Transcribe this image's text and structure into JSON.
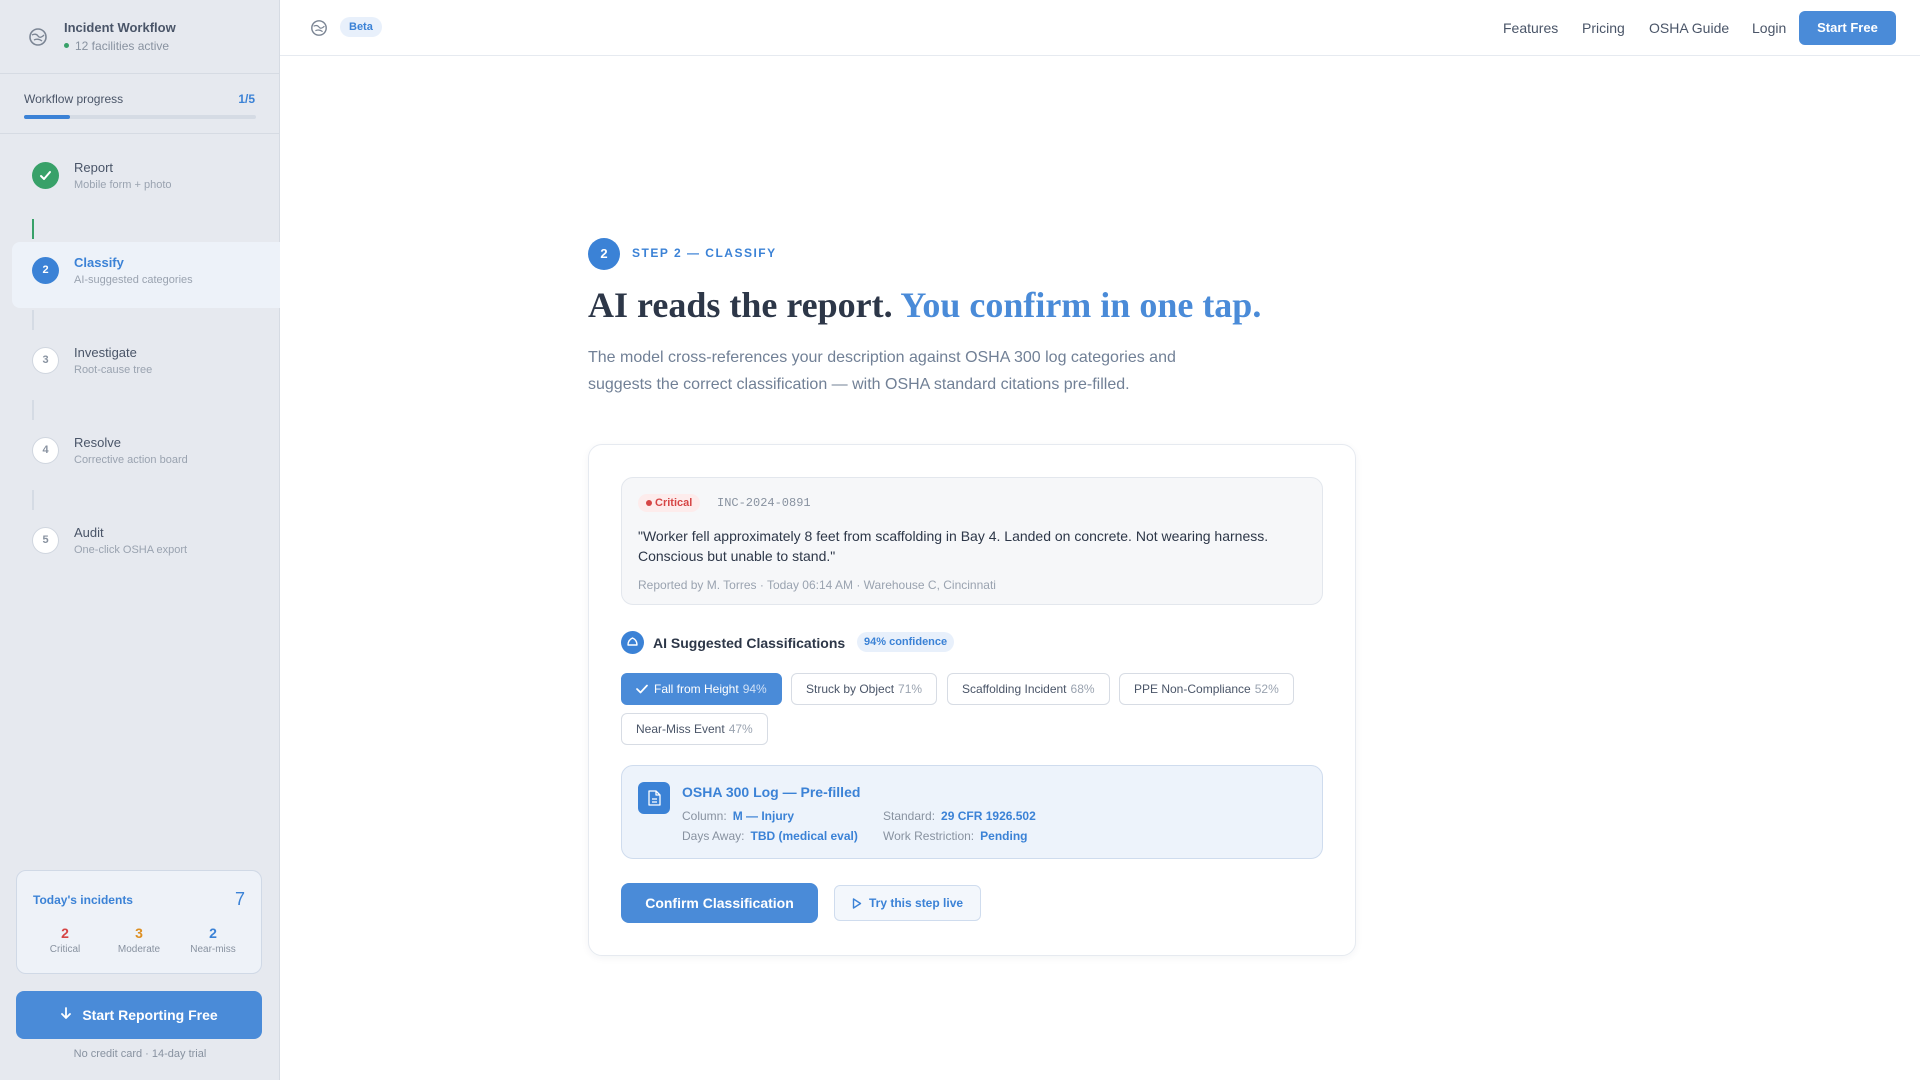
{
  "sidebar": {
    "title": "Incident Workflow",
    "subtitle": "12 facilities active",
    "progress": {
      "label": "Workflow progress",
      "count": "1/5",
      "fraction": 0.2
    },
    "steps": [
      {
        "num": "",
        "title": "Report",
        "desc": "Mobile form + photo",
        "state": "done"
      },
      {
        "num": "2",
        "title": "Classify",
        "desc": "AI-suggested categories",
        "state": "current"
      },
      {
        "num": "3",
        "title": "Investigate",
        "desc": "Root-cause tree",
        "state": "todo"
      },
      {
        "num": "4",
        "title": "Resolve",
        "desc": "Corrective action board",
        "state": "todo"
      },
      {
        "num": "5",
        "title": "Audit",
        "desc": "One-click OSHA export",
        "state": "todo"
      }
    ],
    "incidents": {
      "title": "Today's incidents",
      "total": "7",
      "stats": [
        {
          "value": "2",
          "label": "Critical",
          "color": "#d64545"
        },
        {
          "value": "3",
          "label": "Moderate",
          "color": "#dd8f22"
        },
        {
          "value": "2",
          "label": "Near-miss",
          "color": "#3b82d6"
        }
      ]
    },
    "cta": {
      "label": "Start Reporting Free",
      "note": "No credit card · 14-day trial"
    }
  },
  "nav": {
    "badge": "Beta",
    "links": [
      "Features",
      "Pricing",
      "OSHA Guide",
      "Login"
    ],
    "button": "Start Free"
  },
  "main": {
    "step_number": "2",
    "kicker": "STEP 2 — CLASSIFY",
    "headline": "AI reads the report.",
    "headline_accent": "You confirm in one tap.",
    "lead": "The model cross-references your description against OSHA 300 log categories and suggests the correct classification — with OSHA standard citations pre-filled.",
    "report": {
      "severity": "Critical",
      "id": "INC-2024-0891",
      "quote": "\"Worker fell approximately 8 feet from scaffolding in Bay 4. Landed on concrete. Not wearing harness. Conscious but unable to stand.\"",
      "meta": "Reported by M. Torres · Today 06:14 AM · Warehouse C, Cincinnati"
    },
    "ai": {
      "title": "AI Suggested Classifications",
      "confidence": "94% confidence",
      "chips": [
        {
          "label": "Fall from Height",
          "pct": "94%",
          "selected": true
        },
        {
          "label": "Struck by Object",
          "pct": "71%",
          "selected": false
        },
        {
          "label": "Scaffolding Incident",
          "pct": "68%",
          "selected": false
        },
        {
          "label": "PPE Non-Compliance",
          "pct": "52%",
          "selected": false
        },
        {
          "label": "Near-Miss Event",
          "pct": "47%",
          "selected": false
        }
      ]
    },
    "osha": {
      "title": "OSHA 300 Log — Pre-filled",
      "column_label": "Column:",
      "column_value": "M — Injury",
      "standard_label": "Standard:",
      "standard_value": "29 CFR 1926.502",
      "days_label": "Days Away:",
      "days_value": "TBD (medical eval)",
      "restriction_label": "Work Restriction:",
      "restriction_value": "Pending"
    },
    "confirm_button": "Confirm Classification",
    "try_button": "Try this step live"
  }
}
